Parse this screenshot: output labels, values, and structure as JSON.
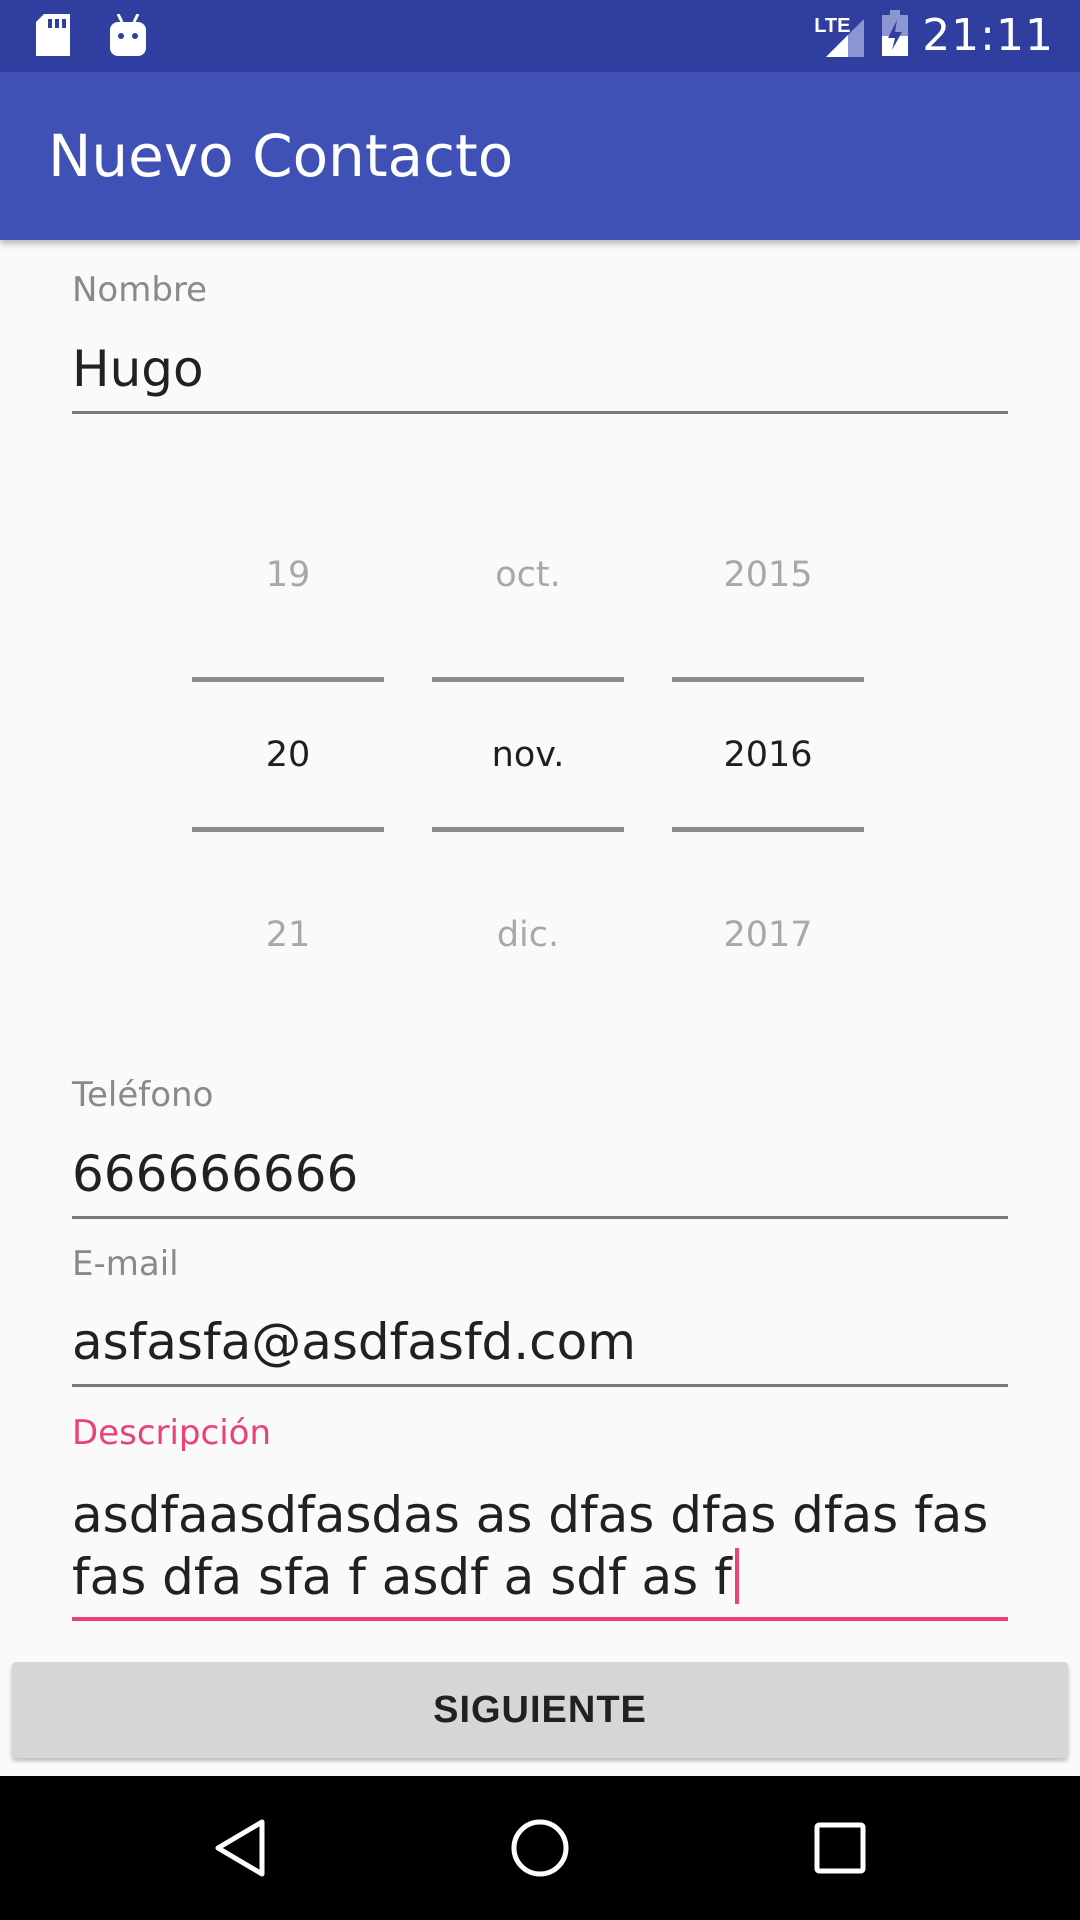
{
  "status_bar": {
    "time": "21:11",
    "network": "LTE",
    "icons": [
      "sd-card-icon",
      "android-debug-icon",
      "signal-icon",
      "battery-charging-icon"
    ]
  },
  "app_bar": {
    "title": "Nuevo Contacto"
  },
  "form": {
    "nombre": {
      "label": "Nombre",
      "value": "Hugo"
    },
    "date_picker": {
      "day": {
        "prev": "19",
        "selected": "20",
        "next": "21"
      },
      "month": {
        "prev": "oct.",
        "selected": "nov.",
        "next": "dic."
      },
      "year": {
        "prev": "2015",
        "selected": "2016",
        "next": "2017"
      }
    },
    "telefono": {
      "label": "Teléfono",
      "value": "666666666"
    },
    "email": {
      "label": "E-mail",
      "value": "asfasfa@asdfasfd.com"
    },
    "descripcion": {
      "label": "Descripción",
      "line1": "asdfaasdfasdas as dfas dfas dfas fas",
      "line2": "fas dfa sfa f asdf a sdf as f"
    }
  },
  "buttons": {
    "next_label": "SIGUIENTE"
  },
  "colors": {
    "status_bar": "#303f9f",
    "app_bar": "#3f51b5",
    "accent": "#ec407a",
    "background": "#fafafa"
  },
  "nav_bar": {
    "icons": [
      "back-icon",
      "home-icon",
      "recents-icon"
    ]
  }
}
